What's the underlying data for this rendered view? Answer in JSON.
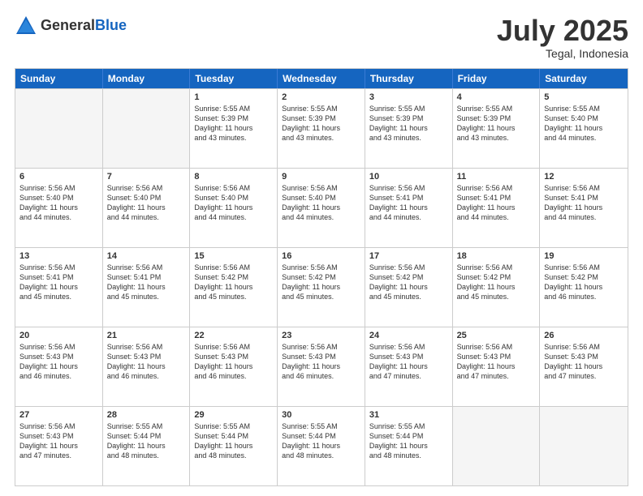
{
  "header": {
    "logo_general": "General",
    "logo_blue": "Blue",
    "month": "July 2025",
    "location": "Tegal, Indonesia"
  },
  "days_of_week": [
    "Sunday",
    "Monday",
    "Tuesday",
    "Wednesday",
    "Thursday",
    "Friday",
    "Saturday"
  ],
  "weeks": [
    [
      {
        "day": "",
        "info": ""
      },
      {
        "day": "",
        "info": ""
      },
      {
        "day": "1",
        "info": "Sunrise: 5:55 AM\nSunset: 5:39 PM\nDaylight: 11 hours\nand 43 minutes."
      },
      {
        "day": "2",
        "info": "Sunrise: 5:55 AM\nSunset: 5:39 PM\nDaylight: 11 hours\nand 43 minutes."
      },
      {
        "day": "3",
        "info": "Sunrise: 5:55 AM\nSunset: 5:39 PM\nDaylight: 11 hours\nand 43 minutes."
      },
      {
        "day": "4",
        "info": "Sunrise: 5:55 AM\nSunset: 5:39 PM\nDaylight: 11 hours\nand 43 minutes."
      },
      {
        "day": "5",
        "info": "Sunrise: 5:55 AM\nSunset: 5:40 PM\nDaylight: 11 hours\nand 44 minutes."
      }
    ],
    [
      {
        "day": "6",
        "info": "Sunrise: 5:56 AM\nSunset: 5:40 PM\nDaylight: 11 hours\nand 44 minutes."
      },
      {
        "day": "7",
        "info": "Sunrise: 5:56 AM\nSunset: 5:40 PM\nDaylight: 11 hours\nand 44 minutes."
      },
      {
        "day": "8",
        "info": "Sunrise: 5:56 AM\nSunset: 5:40 PM\nDaylight: 11 hours\nand 44 minutes."
      },
      {
        "day": "9",
        "info": "Sunrise: 5:56 AM\nSunset: 5:40 PM\nDaylight: 11 hours\nand 44 minutes."
      },
      {
        "day": "10",
        "info": "Sunrise: 5:56 AM\nSunset: 5:41 PM\nDaylight: 11 hours\nand 44 minutes."
      },
      {
        "day": "11",
        "info": "Sunrise: 5:56 AM\nSunset: 5:41 PM\nDaylight: 11 hours\nand 44 minutes."
      },
      {
        "day": "12",
        "info": "Sunrise: 5:56 AM\nSunset: 5:41 PM\nDaylight: 11 hours\nand 44 minutes."
      }
    ],
    [
      {
        "day": "13",
        "info": "Sunrise: 5:56 AM\nSunset: 5:41 PM\nDaylight: 11 hours\nand 45 minutes."
      },
      {
        "day": "14",
        "info": "Sunrise: 5:56 AM\nSunset: 5:41 PM\nDaylight: 11 hours\nand 45 minutes."
      },
      {
        "day": "15",
        "info": "Sunrise: 5:56 AM\nSunset: 5:42 PM\nDaylight: 11 hours\nand 45 minutes."
      },
      {
        "day": "16",
        "info": "Sunrise: 5:56 AM\nSunset: 5:42 PM\nDaylight: 11 hours\nand 45 minutes."
      },
      {
        "day": "17",
        "info": "Sunrise: 5:56 AM\nSunset: 5:42 PM\nDaylight: 11 hours\nand 45 minutes."
      },
      {
        "day": "18",
        "info": "Sunrise: 5:56 AM\nSunset: 5:42 PM\nDaylight: 11 hours\nand 45 minutes."
      },
      {
        "day": "19",
        "info": "Sunrise: 5:56 AM\nSunset: 5:42 PM\nDaylight: 11 hours\nand 46 minutes."
      }
    ],
    [
      {
        "day": "20",
        "info": "Sunrise: 5:56 AM\nSunset: 5:43 PM\nDaylight: 11 hours\nand 46 minutes."
      },
      {
        "day": "21",
        "info": "Sunrise: 5:56 AM\nSunset: 5:43 PM\nDaylight: 11 hours\nand 46 minutes."
      },
      {
        "day": "22",
        "info": "Sunrise: 5:56 AM\nSunset: 5:43 PM\nDaylight: 11 hours\nand 46 minutes."
      },
      {
        "day": "23",
        "info": "Sunrise: 5:56 AM\nSunset: 5:43 PM\nDaylight: 11 hours\nand 46 minutes."
      },
      {
        "day": "24",
        "info": "Sunrise: 5:56 AM\nSunset: 5:43 PM\nDaylight: 11 hours\nand 47 minutes."
      },
      {
        "day": "25",
        "info": "Sunrise: 5:56 AM\nSunset: 5:43 PM\nDaylight: 11 hours\nand 47 minutes."
      },
      {
        "day": "26",
        "info": "Sunrise: 5:56 AM\nSunset: 5:43 PM\nDaylight: 11 hours\nand 47 minutes."
      }
    ],
    [
      {
        "day": "27",
        "info": "Sunrise: 5:56 AM\nSunset: 5:43 PM\nDaylight: 11 hours\nand 47 minutes."
      },
      {
        "day": "28",
        "info": "Sunrise: 5:55 AM\nSunset: 5:44 PM\nDaylight: 11 hours\nand 48 minutes."
      },
      {
        "day": "29",
        "info": "Sunrise: 5:55 AM\nSunset: 5:44 PM\nDaylight: 11 hours\nand 48 minutes."
      },
      {
        "day": "30",
        "info": "Sunrise: 5:55 AM\nSunset: 5:44 PM\nDaylight: 11 hours\nand 48 minutes."
      },
      {
        "day": "31",
        "info": "Sunrise: 5:55 AM\nSunset: 5:44 PM\nDaylight: 11 hours\nand 48 minutes."
      },
      {
        "day": "",
        "info": ""
      },
      {
        "day": "",
        "info": ""
      }
    ]
  ]
}
